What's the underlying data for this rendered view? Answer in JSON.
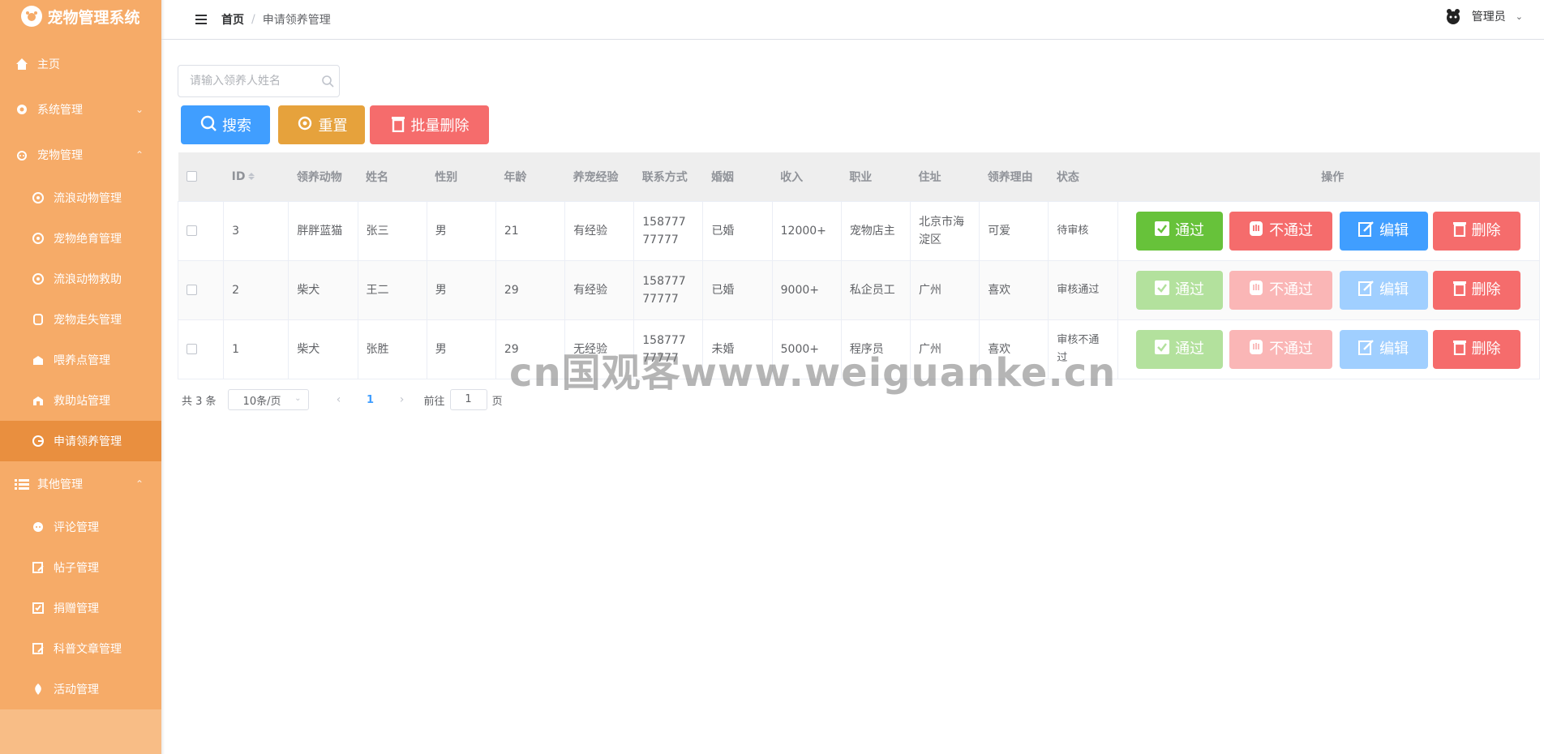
{
  "app": {
    "title": "宠物管理系统"
  },
  "sidebar": {
    "items": [
      {
        "label": "主页",
        "icon": "home-icon"
      },
      {
        "label": "系统管理",
        "icon": "gear-icon"
      },
      {
        "label": "宠物管理",
        "icon": "pet-icon"
      },
      {
        "label": "流浪动物管理",
        "icon": "stray-animal-icon"
      },
      {
        "label": "宠物绝育管理",
        "icon": "neuter-icon"
      },
      {
        "label": "流浪动物救助",
        "icon": "rescue-icon"
      },
      {
        "label": "宠物走失管理",
        "icon": "lost-pet-icon"
      },
      {
        "label": "喂养点管理",
        "icon": "feeding-point-icon"
      },
      {
        "label": "救助站管理",
        "icon": "station-icon"
      },
      {
        "label": "申请领养管理",
        "icon": "adoption-icon"
      },
      {
        "label": "其他管理",
        "icon": "list-icon"
      },
      {
        "label": "评论管理",
        "icon": "comment-icon"
      },
      {
        "label": "帖子管理",
        "icon": "post-icon"
      },
      {
        "label": "捐赠管理",
        "icon": "donate-icon"
      },
      {
        "label": "科普文章管理",
        "icon": "article-icon"
      },
      {
        "label": "活动管理",
        "icon": "activity-icon"
      }
    ]
  },
  "header": {
    "breadcrumb_home": "首页",
    "breadcrumb_sep": "/",
    "breadcrumb_current": "申请领养管理",
    "user": "管理员"
  },
  "search": {
    "placeholder": "请输入领养人姓名"
  },
  "buttons": {
    "search": "搜索",
    "reset": "重置",
    "batch_delete": "批量删除"
  },
  "table": {
    "headers": [
      "ID",
      "领养动物",
      "姓名",
      "性别",
      "年龄",
      "养宠经验",
      "联系方式",
      "婚姻",
      "收入",
      "职业",
      "住址",
      "领养理由",
      "状态",
      "操作"
    ],
    "rows": [
      {
        "id": "3",
        "animal": "胖胖蓝猫",
        "name": "张三",
        "gender": "男",
        "age": "21",
        "experience": "有经验",
        "phone": "15877777777",
        "marriage": "已婚",
        "income": "12000+",
        "job": "宠物店主",
        "address": "北京市海淀区",
        "reason": "可爱",
        "status": "待审核"
      },
      {
        "id": "2",
        "animal": "柴犬",
        "name": "王二",
        "gender": "男",
        "age": "29",
        "experience": "有经验",
        "phone": "15877777777",
        "marriage": "已婚",
        "income": "9000+",
        "job": "私企员工",
        "address": "广州",
        "reason": "喜欢",
        "status": "审核通过"
      },
      {
        "id": "1",
        "animal": "柴犬",
        "name": "张胜",
        "gender": "男",
        "age": "29",
        "experience": "无经验",
        "phone": "15877777777",
        "marriage": "未婚",
        "income": "5000+",
        "job": "程序员",
        "address": "广州",
        "reason": "喜欢",
        "status": "审核不通过"
      }
    ],
    "actions": {
      "pass": "通过",
      "reject": "不通过",
      "edit": "编辑",
      "delete": "删除"
    }
  },
  "pagination": {
    "total": "共 3 条",
    "page_size": "10条/页",
    "current": "1",
    "goto_label": "前往",
    "goto_value": "1",
    "page_suffix": "页"
  },
  "watermark": "cn国观客www.weiguanke.cn",
  "colors": {
    "sidebar": "#f6ab68",
    "sidebar_active": "#e98f3f",
    "primary": "#409eff",
    "success": "#67c23a",
    "warning": "#e6a23c",
    "danger": "#f56c6c"
  }
}
